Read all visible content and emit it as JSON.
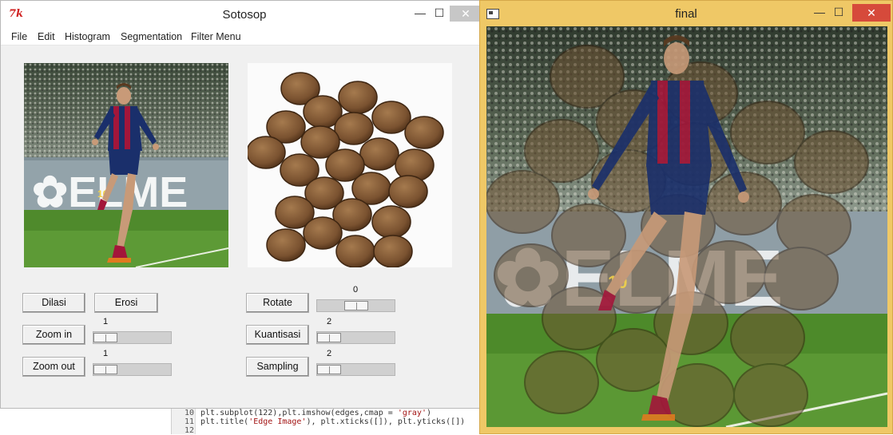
{
  "editor": {
    "lines": [
      {
        "num": "10",
        "pre": "plt.subplot(122),plt.imshow(edges,cmap = ",
        "str": "'gray'",
        "post": ")"
      },
      {
        "num": "11",
        "pre": "plt.title(",
        "str": "'Edge Image'",
        "post": "), plt.xticks([]), plt.yticks([])"
      },
      {
        "num": "12",
        "pre": "",
        "str": "",
        "post": ""
      }
    ]
  },
  "tk_window": {
    "logo": "7k",
    "title": "Sotosop",
    "minimize": "—",
    "maximize": "☐",
    "close": "✕",
    "menu": [
      "File",
      "Edit",
      "Histogram",
      "Segmentation",
      "Filter Menu"
    ],
    "buttons": {
      "dilasi": "Dilasi",
      "erosi": "Erosi",
      "zoom_in": "Zoom in",
      "zoom_out": "Zoom out",
      "rotate": "Rotate",
      "kuantisasi": "Kuantisasi",
      "sampling": "Sampling"
    },
    "scales": {
      "zoom_in": {
        "value": "1",
        "level": 0.0
      },
      "zoom_out": {
        "value": "1",
        "level": 0.0
      },
      "rotate": {
        "value": "0",
        "level": 0.5
      },
      "kuantisasi": {
        "value": "2",
        "level": 0.0
      },
      "sampling": {
        "value": "2",
        "level": 0.0
      }
    }
  },
  "final_window": {
    "title": "final",
    "minimize": "—",
    "maximize": "☐",
    "close": "✕"
  },
  "colors": {
    "final_frame": "#efc866",
    "close_red": "#d64a3b",
    "jersey_blue": "#1a2f6b",
    "jersey_red": "#a3163a",
    "pitch_green": "#4f8a2c",
    "coin_bronze": "#7a5230"
  },
  "icons": {
    "tk_logo": "tk-feather-logo",
    "final_icon": "window-app-icon"
  }
}
